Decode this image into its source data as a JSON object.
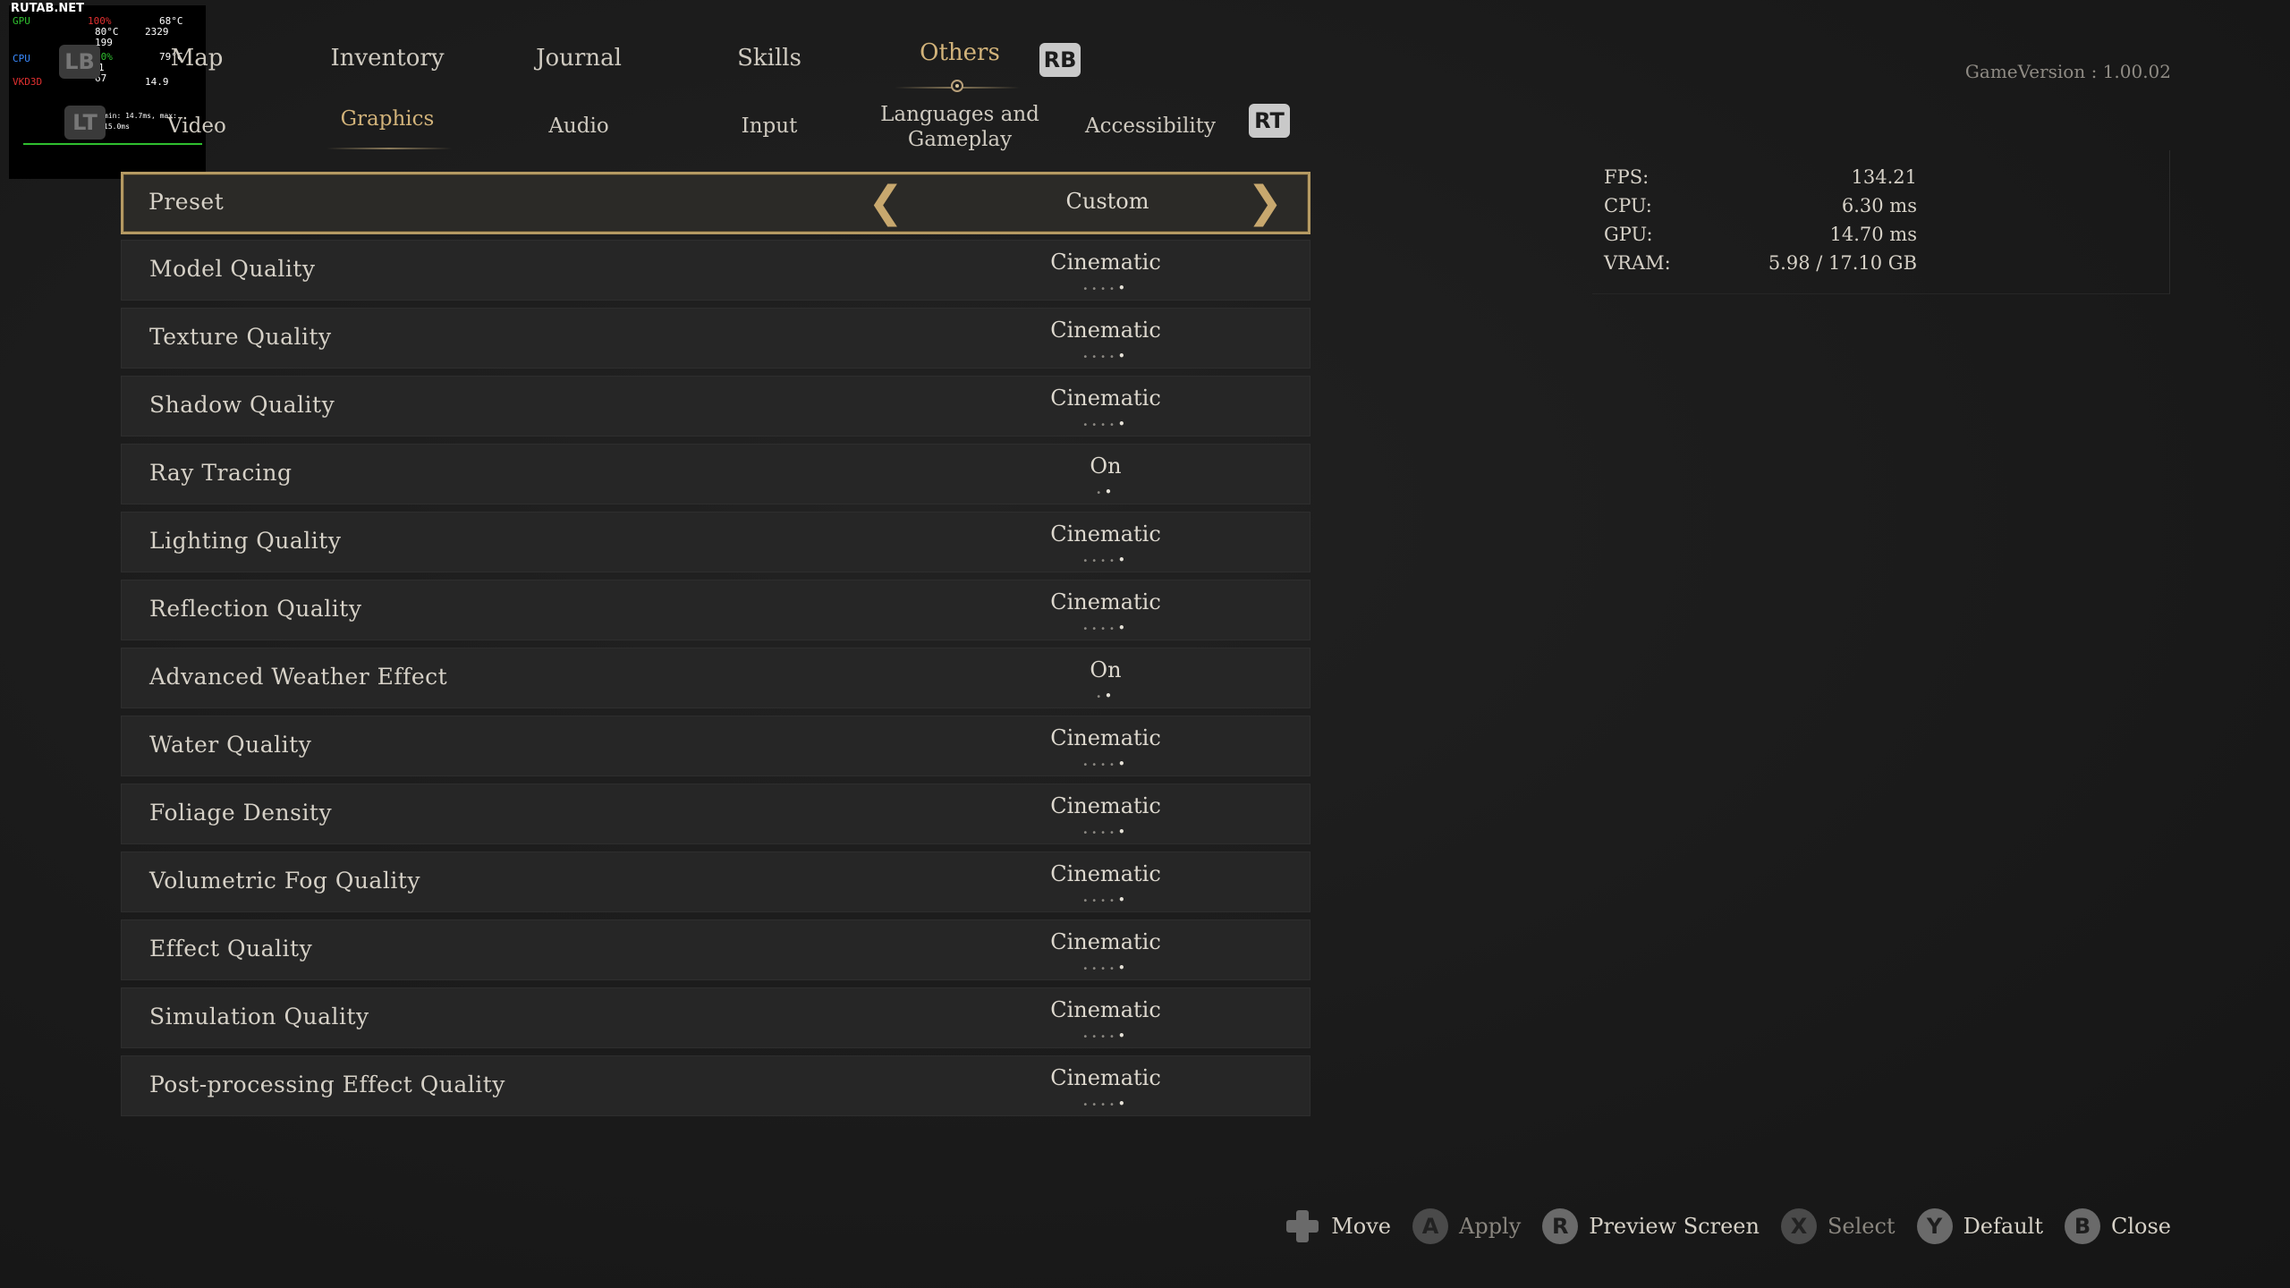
{
  "overlay": {
    "site": "RUTAB.NET",
    "gpu_label": "GPU",
    "gpu_load": "100%",
    "gpu_temp": "68°C",
    "gpu_hotspot": "80°C",
    "gpu_clock": "2329",
    "gpu_power": "199",
    "cpu_label": "CPU",
    "cpu_load": "10%",
    "cpu_temp": "79°C",
    "cpu_clock": "4551",
    "fps": "67",
    "frametime": "14.9",
    "api": "VKD3D",
    "minmax": "min: 14.7ms, max: 15.0ms"
  },
  "tabs": {
    "lb_badge": "LB",
    "rb_badge": "RB",
    "main": [
      "Map",
      "Inventory",
      "Journal",
      "Skills",
      "Others"
    ],
    "active_main": "Others"
  },
  "subtabs": {
    "lt_badge": "LT",
    "rt_badge": "RT",
    "items": [
      "Video",
      "Graphics",
      "Audio",
      "Input",
      "Languages and Gameplay",
      "Accessibility"
    ],
    "active": "Graphics"
  },
  "version": "GameVersion : 1.00.02",
  "settings": {
    "preset": {
      "label": "Preset",
      "value": "Custom"
    },
    "rows": [
      {
        "label": "Model Quality",
        "value": "Cinematic"
      },
      {
        "label": "Texture Quality",
        "value": "Cinematic"
      },
      {
        "label": "Shadow Quality",
        "value": "Cinematic"
      },
      {
        "label": "Ray Tracing",
        "value": "On"
      },
      {
        "label": "Lighting Quality",
        "value": "Cinematic"
      },
      {
        "label": "Reflection Quality",
        "value": "Cinematic"
      },
      {
        "label": "Advanced Weather Effect",
        "value": "On"
      },
      {
        "label": "Water Quality",
        "value": "Cinematic"
      },
      {
        "label": "Foliage Density",
        "value": "Cinematic"
      },
      {
        "label": "Volumetric Fog Quality",
        "value": "Cinematic"
      },
      {
        "label": "Effect Quality",
        "value": "Cinematic"
      },
      {
        "label": "Simulation Quality",
        "value": "Cinematic"
      },
      {
        "label": "Post-processing Effect Quality",
        "value": "Cinematic"
      }
    ]
  },
  "stats": [
    {
      "label": "FPS:",
      "value": "134.21"
    },
    {
      "label": "CPU:",
      "value": "6.30  ms"
    },
    {
      "label": "GPU:",
      "value": "14.70  ms"
    },
    {
      "label": "VRAM:",
      "value": "5.98  /  17.10  GB"
    }
  ],
  "hints": {
    "move": "Move",
    "apply": "Apply",
    "preview": "Preview  Screen",
    "select": "Select",
    "default": "Default",
    "close": "Close",
    "a_btn": "A",
    "r_btn": "R",
    "x_btn": "X",
    "y_btn": "Y",
    "b_btn": "B"
  }
}
